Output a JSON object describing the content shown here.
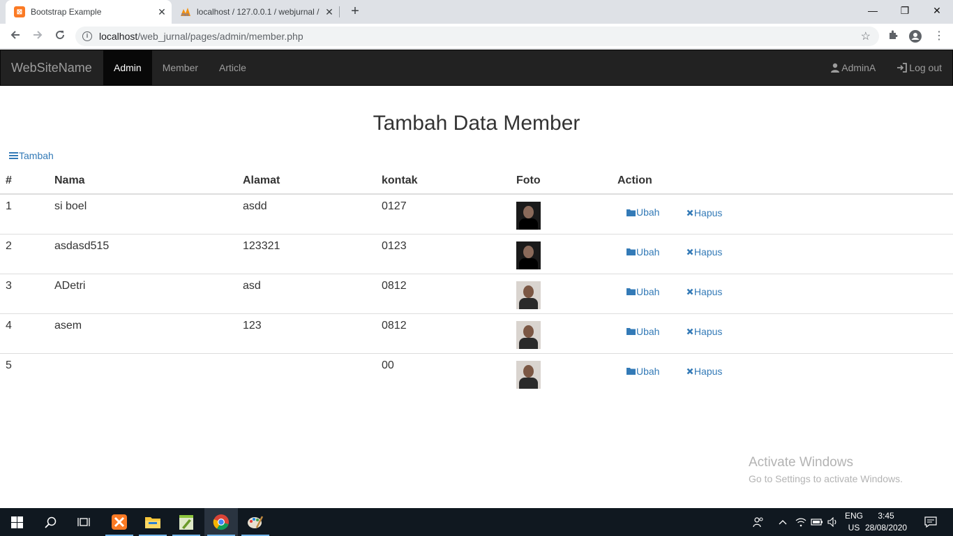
{
  "browser": {
    "tabs": [
      {
        "title": "Bootstrap Example",
        "active": true
      },
      {
        "title": "localhost / 127.0.0.1 / webjurnal /",
        "active": false
      }
    ],
    "url_host": "localhost",
    "url_path": "/web_jurnal/pages/admin/member.php"
  },
  "navbar": {
    "brand": "WebSiteName",
    "items": [
      {
        "label": "Admin",
        "active": true
      },
      {
        "label": "Member",
        "active": false
      },
      {
        "label": "Article",
        "active": false
      }
    ],
    "user_label": "AdminA",
    "logout_label": "Log out"
  },
  "page": {
    "title": "Tambah Data Member",
    "add_label": "Tambah"
  },
  "table": {
    "columns": [
      "#",
      "Nama",
      "Alamat",
      "kontak",
      "Foto",
      "Action"
    ],
    "rows": [
      {
        "no": "1",
        "nama": "si boel",
        "alamat": "asdd",
        "kontak": "0127"
      },
      {
        "no": "2",
        "nama": "asdasd515",
        "alamat": "123321",
        "kontak": "0123"
      },
      {
        "no": "3",
        "nama": "ADetri",
        "alamat": "asd",
        "kontak": "0812"
      },
      {
        "no": "4",
        "nama": "asem",
        "alamat": "123",
        "kontak": "0812"
      },
      {
        "no": "5",
        "nama": "",
        "alamat": "",
        "kontak": "00"
      }
    ],
    "edit_label": "Ubah",
    "delete_label": "Hapus"
  },
  "watermark": {
    "line1": "Activate Windows",
    "line2": "Go to Settings to activate Windows."
  },
  "taskbar": {
    "lang_line1": "ENG",
    "lang_line2": "US",
    "time": "3:45",
    "date": "28/08/2020"
  },
  "colors": {
    "link": "#337ab7",
    "navbar_bg": "#222222",
    "taskbar_bg": "#101820"
  }
}
